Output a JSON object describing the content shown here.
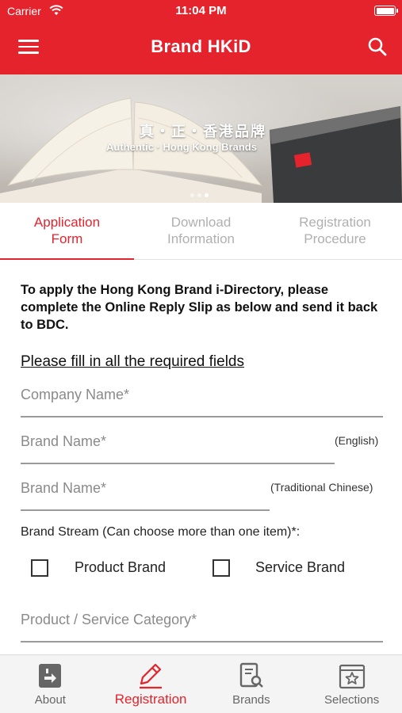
{
  "status_bar": {
    "carrier": "Carrier",
    "time": "11:04 PM"
  },
  "header": {
    "title": "Brand HKiD",
    "menu_icon": "hamburger-menu-icon",
    "search_icon": "search-icon",
    "background": "#e5232d"
  },
  "banner": {
    "chinese_text": "真・正・香港品牌",
    "english_text": "Authentic · Hong Kong Brands",
    "slide_count": 3,
    "active_slide": 2
  },
  "tabs": [
    {
      "label_line1": "Application",
      "label_line2": "Form",
      "active": true
    },
    {
      "label_line1": "Download",
      "label_line2": "Information",
      "active": false
    },
    {
      "label_line1": "Registration",
      "label_line2": "Procedure",
      "active": false
    }
  ],
  "form": {
    "intro": "To apply the Hong Kong Brand i-Directory, please complete the Online Reply Slip as below and send it back to BDC.",
    "required_note": "Please fill in all the required fields",
    "company_name": {
      "placeholder": "Company Name*",
      "value": ""
    },
    "brand_name_en": {
      "placeholder": "Brand Name*",
      "note": "(English)",
      "value": ""
    },
    "brand_name_zh": {
      "placeholder": "Brand Name*",
      "note": "(Traditional Chinese)",
      "value": ""
    },
    "brand_stream_label": "Brand Stream (Can choose more than one item)*:",
    "options": [
      {
        "label": "Product Brand",
        "checked": false
      },
      {
        "label": "Service Brand",
        "checked": false
      }
    ],
    "category": {
      "placeholder": "Product / Service Category*",
      "value": ""
    }
  },
  "bottom_nav": [
    {
      "label": "About",
      "icon": "about-icon",
      "active": false
    },
    {
      "label": "Registration",
      "icon": "pencil-icon",
      "active": true
    },
    {
      "label": "Brands",
      "icon": "brands-search-icon",
      "active": false
    },
    {
      "label": "Selections",
      "icon": "star-icon",
      "active": false
    }
  ],
  "accent_color": "#e5232d"
}
